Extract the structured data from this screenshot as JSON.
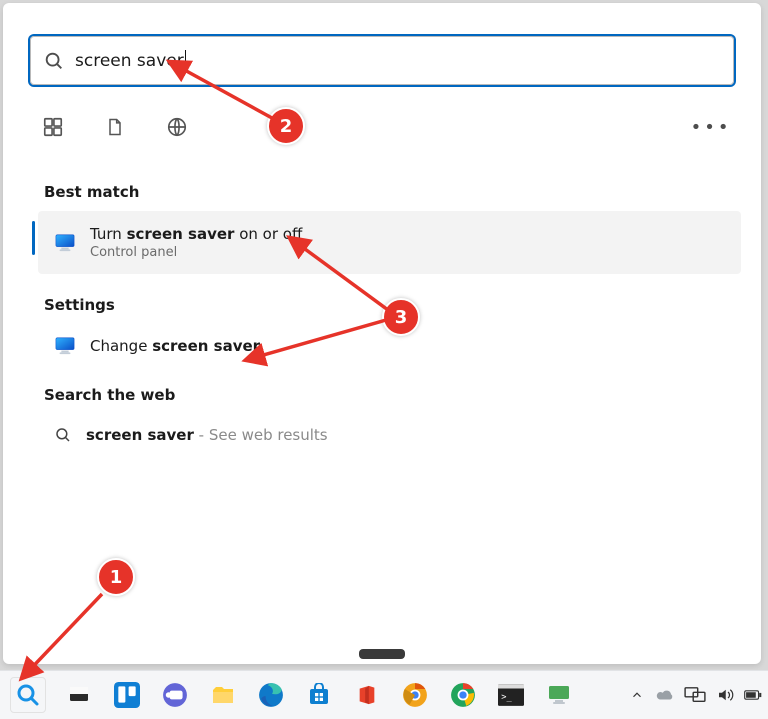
{
  "search": {
    "query": "screen saver",
    "placeholder": ""
  },
  "filters": {
    "apps": "Apps",
    "documents": "Documents",
    "web": "Web",
    "more": "More"
  },
  "results": {
    "best_heading": "Best match",
    "best": {
      "title_prefix": "Turn ",
      "title_bold": "screen saver",
      "title_suffix": " on or off",
      "subtitle": "Control panel"
    },
    "settings_heading": "Settings",
    "settings_item": {
      "title_prefix": "Change ",
      "title_bold": "screen saver"
    },
    "web_heading": "Search the web",
    "web_item": {
      "title_prefix": "",
      "title_bold": "screen saver",
      "title_suffix": " - See web results"
    }
  },
  "annotations": {
    "b1": "1",
    "b2": "2",
    "b3": "3"
  }
}
